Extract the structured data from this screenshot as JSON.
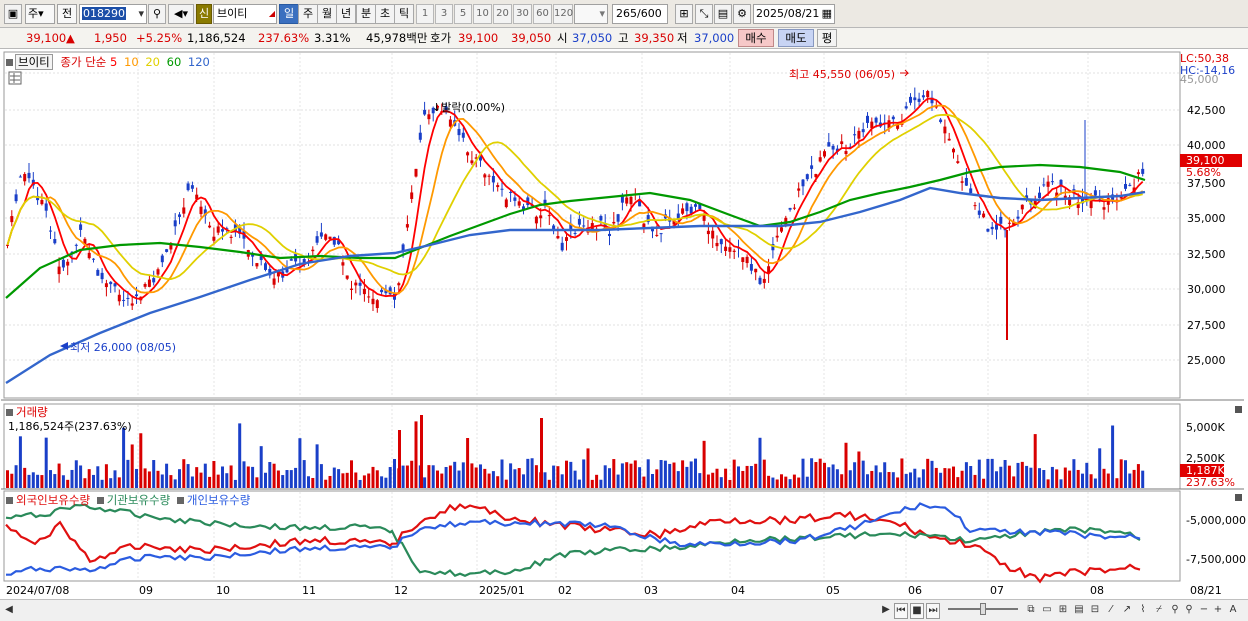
{
  "toolbar": {
    "period_opts": [
      "주",
      "전"
    ],
    "code": "018290",
    "sin_label": "신",
    "stock_name": "브이티",
    "periods": [
      "일",
      "주",
      "월",
      "년",
      "분",
      "초",
      "틱"
    ],
    "intervals": [
      "1",
      "3",
      "5",
      "10",
      "20",
      "30",
      "60",
      "120"
    ],
    "count": "265",
    "count_total": "/600",
    "date": "2025/08/21"
  },
  "quote": {
    "price": "39,100",
    "change": "1,950",
    "change_pct": "+5.25%",
    "volume": "1,186,524",
    "volume_pct": "237.63%",
    "turnover": "3.31%",
    "amount": "45,978백만",
    "ask_label": "호가",
    "ask_price": "39,100",
    "bid_price": "39,050",
    "open_label": "시",
    "open": "37,050",
    "high_label": "고",
    "high": "39,350",
    "low_label": "저",
    "low": "37,000",
    "buy_label": "매수",
    "sell_label": "매도",
    "eval_label": "평"
  },
  "legend": {
    "name": "브이티",
    "title": "종가 단순",
    "ma": [
      {
        "label": "5",
        "color": "#ff0000"
      },
      {
        "label": "10",
        "color": "#ff9900"
      },
      {
        "label": "20",
        "color": "#e0d000"
      },
      {
        "label": "60",
        "color": "#009900"
      },
      {
        "label": "120",
        "color": "#3366cc"
      }
    ]
  },
  "price_axis": {
    "lc": "LC:50,38",
    "hc": "HC:-14,16",
    "ticks": [
      "45,000",
      "42,500",
      "40,000",
      "37,500",
      "35,000",
      "32,500",
      "30,000",
      "27,500",
      "25,000"
    ],
    "current": "39,100",
    "current_pct": "5.68%"
  },
  "annotations": {
    "high": "최고 45,550 (06/05)",
    "low": "최저 26,000 (08/05)",
    "zero": "↓발락(0.00%)"
  },
  "volume": {
    "title": "거래량",
    "value": "1,186,524주(237.63%)",
    "ticks": [
      "5,000K",
      "2,500K"
    ],
    "current": "1,187K",
    "current_pct": "237.63%"
  },
  "holdings": {
    "foreign": "외국인보유수량",
    "inst": "기관보유수량",
    "indiv": "개인보유수량",
    "ticks": [
      "-5,000,000",
      "-7,500,000"
    ]
  },
  "xaxis": [
    "2024/07/08",
    "09",
    "10",
    "11",
    "12",
    "2025/01",
    "02",
    "03",
    "04",
    "05",
    "06",
    "07",
    "08",
    "08/21"
  ],
  "colors": {
    "up": "#d80000",
    "down": "#1a3fc8",
    "foreign": "#e01010",
    "inst": "#2a8a5a",
    "indiv": "#2b5ce0"
  }
}
